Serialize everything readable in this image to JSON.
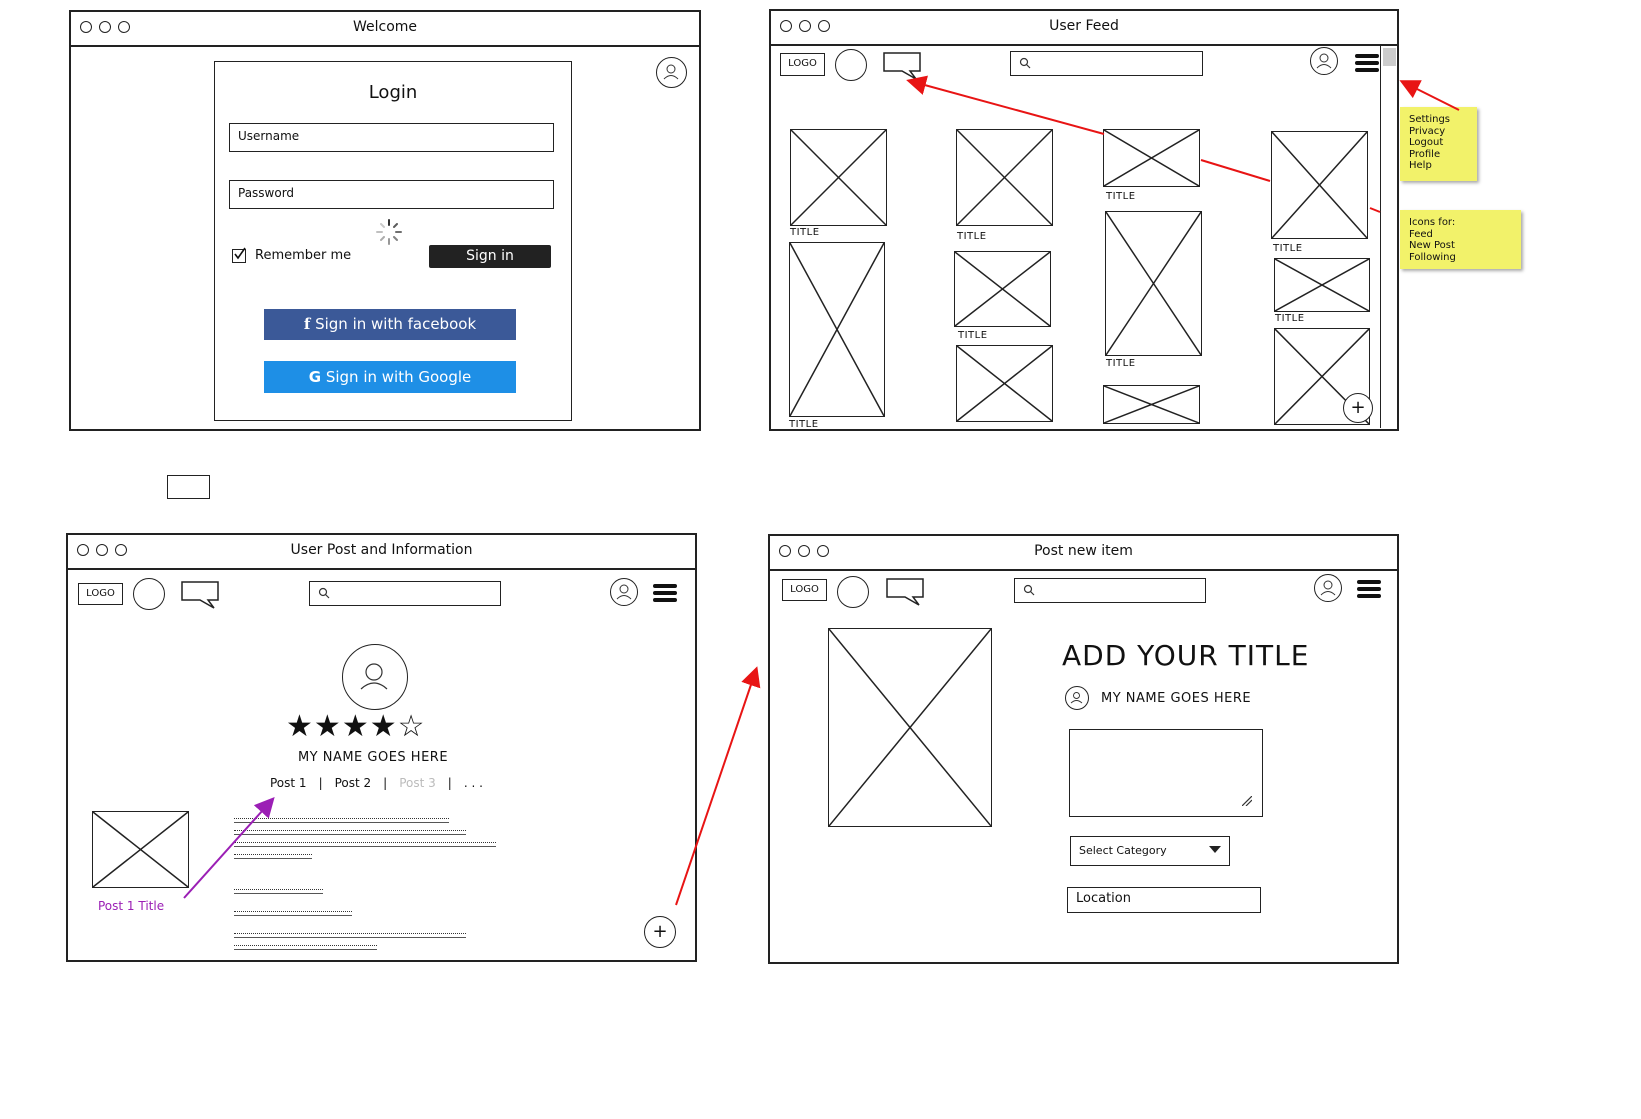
{
  "welcome": {
    "window_title": "Welcome",
    "login_title": "Login",
    "username_placeholder": "Username",
    "password_placeholder": "Password",
    "remember_label": "Remember me",
    "signin_label": "Sign in",
    "facebook_label": "Sign in with facebook",
    "google_label": "Sign in with Google"
  },
  "feed": {
    "window_title": "User Feed",
    "logo_label": "LOGO",
    "tile_label": "TITLE",
    "plus_label": "+"
  },
  "sticky_menu": [
    "Settings",
    "Privacy",
    "Logout",
    "Profile",
    "Help"
  ],
  "sticky_icons": [
    "Icons for:",
    "Feed",
    "New Post",
    "Following"
  ],
  "profile": {
    "window_title": "User Post and Information",
    "logo_label": "LOGO",
    "name": "MY NAME GOES HERE",
    "tabs": [
      {
        "label": "Post 1",
        "sep": "|"
      },
      {
        "label": "Post 2",
        "sep": "|"
      },
      {
        "label": "Post 3",
        "sep": "|"
      },
      {
        "label": ". . .",
        "sep": ""
      }
    ],
    "post_title": "Post 1 Title",
    "stars": [
      "★",
      "★",
      "★",
      "★",
      "☆"
    ],
    "plus_label": "+"
  },
  "newpost": {
    "window_title": "Post new item",
    "logo_label": "LOGO",
    "heading": "ADD YOUR TITLE",
    "name": "MY NAME GOES HERE",
    "category_label": "Select Category",
    "location_label": "Location"
  },
  "colors": {
    "annotation_red": "#e81414",
    "annotation_purple": "#9b1fb5",
    "sticky": "#f2f26a",
    "facebook": "#3b5998",
    "google": "#1e8fe6"
  },
  "icons": [
    "avatar-icon",
    "search-icon",
    "hamburger-icon",
    "chat-bubble-icon",
    "plus-icon",
    "facebook-icon",
    "google-icon",
    "checkbox-icon",
    "spinner-icon",
    "dropdown-caret-icon",
    "resize-grip-icon"
  ]
}
